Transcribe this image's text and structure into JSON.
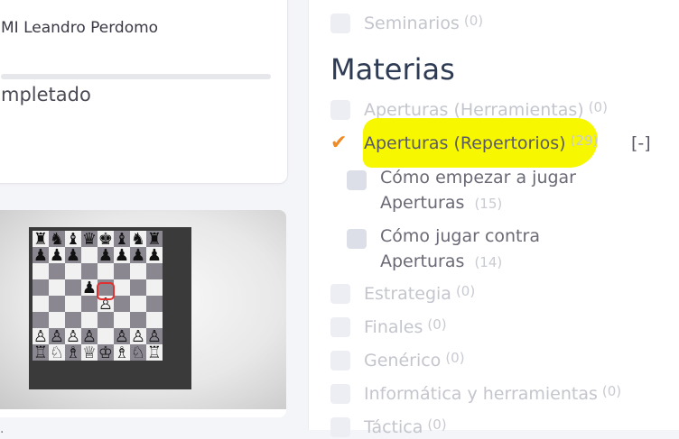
{
  "left": {
    "author": "MI Leandro Perdomo",
    "progress_label": "mpletado",
    "progress_fraction": 0,
    "thumb_caption_stub": "."
  },
  "panel": {
    "seminarios": {
      "label": "Seminarios",
      "count": "(0)"
    },
    "section_title": "Materias",
    "items": [
      {
        "label": "Aperturas (Herramientas)",
        "count": "(0)"
      },
      {
        "label": "Aperturas (Repertorios)",
        "count": "(29)",
        "checked": true
      },
      {
        "label": "Estrategia",
        "count": "(0)"
      },
      {
        "label": "Finales",
        "count": "(0)"
      },
      {
        "label": "Genérico",
        "count": "(0)"
      },
      {
        "label": "Informática y herramientas",
        "count": "(0)"
      },
      {
        "label": "Táctica",
        "count": "(0)"
      }
    ],
    "subitems": [
      {
        "label": "Cómo empezar a jugar Aperturas",
        "count": "(15)"
      },
      {
        "label": "Cómo jugar contra Aperturas",
        "count": "(14)"
      }
    ],
    "collapse_label": "[-]",
    "check_mark": "✔",
    "highlight_color": "#f7f700",
    "check_color": "#f08a24"
  }
}
